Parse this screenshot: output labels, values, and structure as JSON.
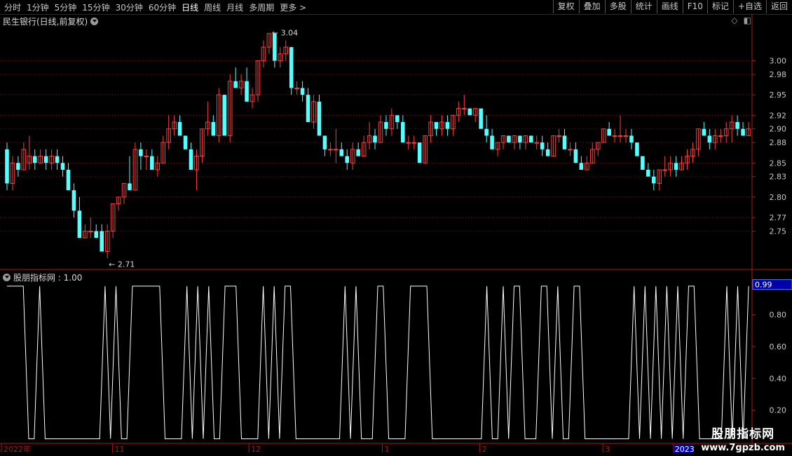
{
  "toolbar": {
    "periods": [
      "分时",
      "1分钟",
      "5分钟",
      "15分钟",
      "30分钟",
      "60分钟",
      "日线",
      "周线",
      "月线",
      "多周期",
      "更多 >"
    ],
    "active_period": "日线",
    "actions": [
      "复权",
      "叠加",
      "多股",
      "统计",
      "画线",
      "F10",
      "标记",
      "+自选",
      "返回"
    ]
  },
  "chart_title": "民生银行(日线,前复权)",
  "indicator_title": "股朋指标网 : 1.00",
  "high_label": "3.04",
  "low_label": "2.71",
  "price_axis": [
    "3.00",
    "2.98",
    "2.95",
    "2.92",
    "2.90",
    "2.88",
    "2.85",
    "2.83",
    "2.80",
    "2.77",
    "2.75"
  ],
  "indicator_axis": [
    "0.80",
    "0.60",
    "0.40",
    "0.20"
  ],
  "indicator_current": "0.99",
  "date_axis": [
    "2022年",
    "11",
    "12",
    "1",
    "2",
    "3",
    "2023"
  ],
  "watermark": {
    "line1": "股朋指标网",
    "line2": "www.7gpzb.com"
  },
  "colors": {
    "up": "#ff3c3c",
    "down": "#54ffff",
    "grid": "#7a1c1c",
    "axis": "#b01818",
    "text": "#c8c8c8"
  },
  "chart_data": {
    "type": "candlestick",
    "ylim": [
      2.7,
      3.05
    ],
    "candles": [
      [
        2.87,
        2.88,
        2.81,
        2.82
      ],
      [
        2.82,
        2.86,
        2.81,
        2.85
      ],
      [
        2.85,
        2.86,
        2.83,
        2.84
      ],
      [
        2.84,
        2.88,
        2.84,
        2.87
      ],
      [
        2.85,
        2.89,
        2.84,
        2.86
      ],
      [
        2.86,
        2.87,
        2.84,
        2.85
      ],
      [
        2.85,
        2.87,
        2.85,
        2.86
      ],
      [
        2.86,
        2.87,
        2.84,
        2.85
      ],
      [
        2.85,
        2.87,
        2.84,
        2.86
      ],
      [
        2.86,
        2.87,
        2.84,
        2.85
      ],
      [
        2.85,
        2.86,
        2.83,
        2.84
      ],
      [
        2.84,
        2.85,
        2.81,
        2.81
      ],
      [
        2.81,
        2.82,
        2.77,
        2.78
      ],
      [
        2.78,
        2.8,
        2.74,
        2.74
      ],
      [
        2.74,
        2.76,
        2.74,
        2.75
      ],
      [
        2.75,
        2.77,
        2.74,
        2.75
      ],
      [
        2.75,
        2.76,
        2.74,
        2.74
      ],
      [
        2.75,
        2.76,
        2.72,
        2.72
      ],
      [
        2.72,
        2.76,
        2.71,
        2.75
      ],
      [
        2.75,
        2.79,
        2.74,
        2.79
      ],
      [
        2.79,
        2.8,
        2.78,
        2.8
      ],
      [
        2.8,
        2.82,
        2.79,
        2.82
      ],
      [
        2.82,
        2.86,
        2.81,
        2.81
      ],
      [
        2.81,
        2.88,
        2.81,
        2.87
      ],
      [
        2.87,
        2.88,
        2.84,
        2.86
      ],
      [
        2.86,
        2.87,
        2.84,
        2.86
      ],
      [
        2.86,
        2.87,
        2.85,
        2.84
      ],
      [
        2.84,
        2.86,
        2.83,
        2.85
      ],
      [
        2.85,
        2.89,
        2.85,
        2.88
      ],
      [
        2.88,
        2.92,
        2.87,
        2.9
      ],
      [
        2.9,
        2.92,
        2.89,
        2.91
      ],
      [
        2.91,
        2.92,
        2.89,
        2.89
      ],
      [
        2.89,
        2.89,
        2.87,
        2.87
      ],
      [
        2.87,
        2.88,
        2.84,
        2.84
      ],
      [
        2.84,
        2.87,
        2.81,
        2.86
      ],
      [
        2.86,
        2.9,
        2.85,
        2.9
      ],
      [
        2.9,
        2.94,
        2.89,
        2.91
      ],
      [
        2.91,
        2.92,
        2.89,
        2.89
      ],
      [
        2.89,
        2.96,
        2.88,
        2.95
      ],
      [
        2.95,
        2.95,
        2.89,
        2.89
      ],
      [
        2.89,
        2.98,
        2.88,
        2.97
      ],
      [
        2.97,
        2.99,
        2.96,
        2.96
      ],
      [
        2.96,
        2.98,
        2.95,
        2.97
      ],
      [
        2.97,
        2.99,
        2.94,
        2.94
      ],
      [
        2.94,
        2.96,
        2.93,
        2.95
      ],
      [
        2.95,
        3.0,
        2.94,
        3.0
      ],
      [
        3.0,
        3.03,
        2.99,
        3.02
      ],
      [
        3.02,
        3.04,
        3.01,
        3.04
      ],
      [
        3.04,
        3.04,
        2.99,
        3.0
      ],
      [
        3.0,
        3.02,
        2.99,
        3.01
      ],
      [
        3.01,
        3.03,
        3.0,
        3.02
      ],
      [
        3.02,
        3.02,
        2.95,
        2.96
      ],
      [
        2.96,
        2.97,
        2.95,
        2.96
      ],
      [
        2.96,
        2.97,
        2.94,
        2.95
      ],
      [
        2.95,
        2.96,
        2.91,
        2.91
      ],
      [
        2.91,
        2.95,
        2.9,
        2.94
      ],
      [
        2.94,
        2.95,
        2.9,
        2.89
      ],
      [
        2.89,
        2.89,
        2.86,
        2.87
      ],
      [
        2.87,
        2.88,
        2.86,
        2.87
      ],
      [
        2.87,
        2.9,
        2.85,
        2.87
      ],
      [
        2.87,
        2.88,
        2.86,
        2.86
      ],
      [
        2.86,
        2.87,
        2.84,
        2.85
      ],
      [
        2.85,
        2.88,
        2.84,
        2.87
      ],
      [
        2.87,
        2.88,
        2.86,
        2.86
      ],
      [
        2.86,
        2.89,
        2.86,
        2.88
      ],
      [
        2.88,
        2.91,
        2.87,
        2.89
      ],
      [
        2.89,
        2.9,
        2.87,
        2.88
      ],
      [
        2.88,
        2.92,
        2.88,
        2.91
      ],
      [
        2.91,
        2.92,
        2.89,
        2.9
      ],
      [
        2.9,
        2.93,
        2.89,
        2.92
      ],
      [
        2.92,
        2.92,
        2.9,
        2.91
      ],
      [
        2.91,
        2.92,
        2.88,
        2.88
      ],
      [
        2.88,
        2.89,
        2.87,
        2.88
      ],
      [
        2.88,
        2.89,
        2.87,
        2.88
      ],
      [
        2.88,
        2.88,
        2.85,
        2.85
      ],
      [
        2.85,
        2.89,
        2.85,
        2.89
      ],
      [
        2.89,
        2.92,
        2.88,
        2.91
      ],
      [
        2.91,
        2.91,
        2.89,
        2.9
      ],
      [
        2.9,
        2.92,
        2.89,
        2.91
      ],
      [
        2.91,
        2.92,
        2.89,
        2.9
      ],
      [
        2.9,
        2.92,
        2.89,
        2.92
      ],
      [
        2.92,
        2.94,
        2.91,
        2.93
      ],
      [
        2.93,
        2.95,
        2.92,
        2.93
      ],
      [
        2.93,
        2.93,
        2.92,
        2.92
      ],
      [
        2.92,
        2.93,
        2.91,
        2.93
      ],
      [
        2.93,
        2.93,
        2.91,
        2.9
      ],
      [
        2.9,
        2.92,
        2.88,
        2.89
      ],
      [
        2.89,
        2.9,
        2.87,
        2.87
      ],
      [
        2.87,
        2.88,
        2.86,
        2.88
      ],
      [
        2.88,
        2.89,
        2.87,
        2.89
      ],
      [
        2.89,
        2.89,
        2.88,
        2.88
      ],
      [
        2.88,
        2.89,
        2.87,
        2.89
      ],
      [
        2.89,
        2.89,
        2.87,
        2.88
      ],
      [
        2.88,
        2.89,
        2.87,
        2.89
      ],
      [
        2.89,
        2.89,
        2.88,
        2.88
      ],
      [
        2.88,
        2.89,
        2.87,
        2.88
      ],
      [
        2.88,
        2.89,
        2.86,
        2.87
      ],
      [
        2.87,
        2.88,
        2.86,
        2.86
      ],
      [
        2.86,
        2.89,
        2.86,
        2.89
      ],
      [
        2.89,
        2.9,
        2.88,
        2.89
      ],
      [
        2.89,
        2.9,
        2.87,
        2.87
      ],
      [
        2.87,
        2.88,
        2.86,
        2.87
      ],
      [
        2.87,
        2.88,
        2.85,
        2.85
      ],
      [
        2.85,
        2.86,
        2.84,
        2.84
      ],
      [
        2.84,
        2.86,
        2.84,
        2.85
      ],
      [
        2.85,
        2.88,
        2.85,
        2.87
      ],
      [
        2.87,
        2.88,
        2.86,
        2.88
      ],
      [
        2.88,
        2.9,
        2.88,
        2.9
      ],
      [
        2.9,
        2.91,
        2.89,
        2.89
      ],
      [
        2.89,
        2.9,
        2.88,
        2.89
      ],
      [
        2.89,
        2.92,
        2.88,
        2.89
      ],
      [
        2.89,
        2.9,
        2.88,
        2.89
      ],
      [
        2.89,
        2.9,
        2.87,
        2.88
      ],
      [
        2.88,
        2.88,
        2.86,
        2.86
      ],
      [
        2.86,
        2.86,
        2.84,
        2.84
      ],
      [
        2.84,
        2.85,
        2.83,
        2.83
      ],
      [
        2.83,
        2.84,
        2.81,
        2.82
      ],
      [
        2.82,
        2.84,
        2.81,
        2.84
      ],
      [
        2.84,
        2.86,
        2.83,
        2.84
      ],
      [
        2.84,
        2.86,
        2.83,
        2.85
      ],
      [
        2.85,
        2.86,
        2.83,
        2.84
      ],
      [
        2.84,
        2.86,
        2.84,
        2.85
      ],
      [
        2.85,
        2.87,
        2.84,
        2.86
      ],
      [
        2.86,
        2.88,
        2.85,
        2.87
      ],
      [
        2.87,
        2.9,
        2.86,
        2.9
      ],
      [
        2.9,
        2.91,
        2.89,
        2.89
      ],
      [
        2.89,
        2.9,
        2.87,
        2.88
      ],
      [
        2.88,
        2.9,
        2.87,
        2.89
      ],
      [
        2.89,
        2.9,
        2.88,
        2.89
      ],
      [
        2.89,
        2.91,
        2.88,
        2.9
      ],
      [
        2.9,
        2.92,
        2.88,
        2.91
      ],
      [
        2.91,
        2.92,
        2.89,
        2.9
      ],
      [
        2.9,
        2.91,
        2.89,
        2.89
      ],
      [
        2.89,
        2.91,
        2.89,
        2.9
      ]
    ],
    "indicator": [
      0.98,
      0.98,
      0.98,
      0.98,
      0.02,
      0.02,
      0.98,
      0.02,
      0.02,
      0.02,
      0.02,
      0.02,
      0.02,
      0.02,
      0.02,
      0.02,
      0.02,
      0.02,
      0.98,
      0.02,
      0.98,
      0.02,
      0.02,
      0.98,
      0.98,
      0.98,
      0.98,
      0.98,
      0.98,
      0.02,
      0.02,
      0.02,
      0.02,
      0.98,
      0.02,
      0.98,
      0.02,
      0.98,
      0.02,
      0.02,
      0.98,
      0.98,
      0.98,
      0.02,
      0.02,
      0.02,
      0.02,
      0.98,
      0.02,
      0.98,
      0.02,
      0.98,
      0.98,
      0.02,
      0.02,
      0.02,
      0.02,
      0.02,
      0.02,
      0.02,
      0.02,
      0.02,
      0.98,
      0.02,
      0.98,
      0.02,
      0.02,
      0.02,
      0.98,
      0.98,
      0.02,
      0.02,
      0.02,
      0.02,
      0.98,
      0.98,
      0.98,
      0.98,
      0.02,
      0.02,
      0.02,
      0.02,
      0.02,
      0.02,
      0.02,
      0.02,
      0.02,
      0.02,
      0.98,
      0.02,
      0.02,
      0.98,
      0.02,
      0.98,
      0.98,
      0.02,
      0.02,
      0.02,
      0.98,
      0.98,
      0.02,
      0.98,
      0.02,
      0.02,
      0.98,
      0.98,
      0.02,
      0.02,
      0.02,
      0.02,
      0.02,
      0.02,
      0.02,
      0.02,
      0.02,
      0.98,
      0.02,
      0.98,
      0.02,
      0.98,
      0.02,
      0.98,
      0.02,
      0.98,
      0.02,
      0.98,
      0.98,
      0.02,
      0.02,
      0.02,
      0.02,
      0.02,
      0.98,
      0.02,
      0.98,
      0.02,
      0.98
    ],
    "ind_ylim": [
      0.0,
      1.05
    ]
  }
}
